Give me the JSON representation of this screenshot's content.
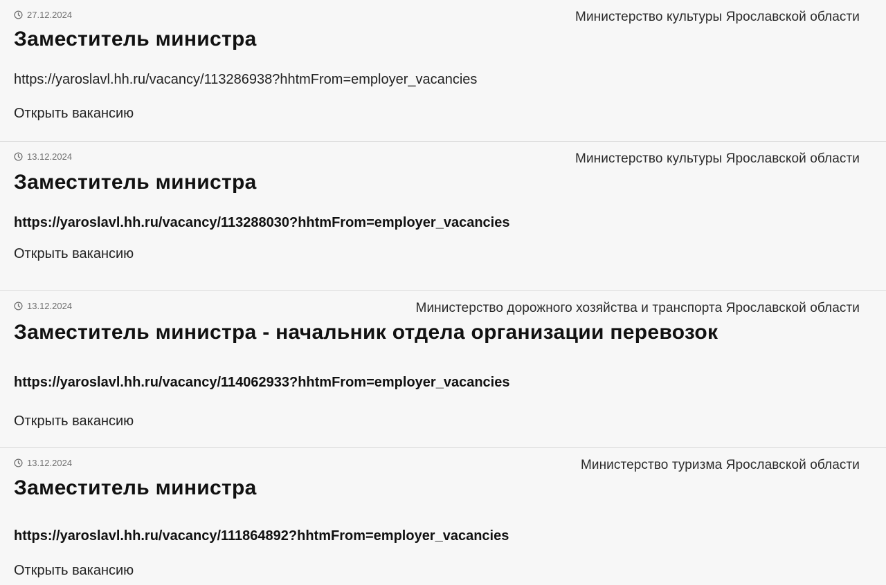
{
  "vacancies": [
    {
      "date": "27.12.2024",
      "organization": "Министерство культуры Ярославской области",
      "title": "Заместитель министра",
      "url": "https://yaroslavl.hh.ru/vacancy/113286938?hhtmFrom=employer_vacancies",
      "open_label": "Открыть вакансию"
    },
    {
      "date": "13.12.2024",
      "organization": "Министерство культуры Ярославской области",
      "title": "Заместитель министра",
      "url": "https://yaroslavl.hh.ru/vacancy/113288030?hhtmFrom=employer_vacancies",
      "open_label": "Открыть вакансию"
    },
    {
      "date": "13.12.2024",
      "organization": "Министерство дорожного хозяйства и транспорта Ярославской области",
      "title": "Заместитель министра - начальник отдела организации перевозок",
      "url": "https://yaroslavl.hh.ru/vacancy/114062933?hhtmFrom=employer_vacancies",
      "open_label": "Открыть вакансию"
    },
    {
      "date": "13.12.2024",
      "organization": "Министерство туризма Ярославской области",
      "title": "Заместитель министра",
      "url": "https://yaroslavl.hh.ru/vacancy/111864892?hhtmFrom=employer_vacancies",
      "open_label": "Открыть вакансию"
    }
  ],
  "icons": {
    "date": "clock-icon"
  },
  "colors": {
    "background": "#f7f7f7",
    "divider": "#dcdcdc",
    "date_text": "#6f6f6f",
    "title_text": "#111111"
  }
}
